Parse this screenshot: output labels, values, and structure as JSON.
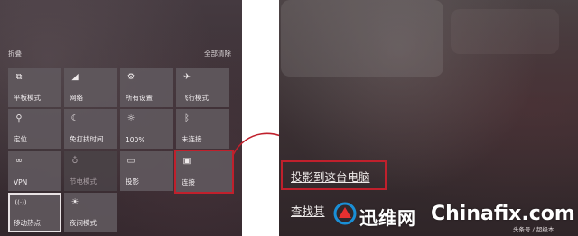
{
  "action_center": {
    "collapse_label": "折叠",
    "clear_all_label": "全部清除",
    "tiles": [
      {
        "label": "平板模式",
        "icon": "tablet-mode-icon",
        "glyph": "⧉",
        "state": "on"
      },
      {
        "label": "网络",
        "icon": "network-icon",
        "glyph": "◢",
        "state": "on"
      },
      {
        "label": "所有设置",
        "icon": "gear-icon",
        "glyph": "⚙",
        "state": "on"
      },
      {
        "label": "飞行模式",
        "icon": "airplane-icon",
        "glyph": "✈",
        "state": "on"
      },
      {
        "label": "定位",
        "icon": "location-icon",
        "glyph": "⚲",
        "state": "on"
      },
      {
        "label": "免打扰时间",
        "icon": "moon-icon",
        "glyph": "☾",
        "state": "on"
      },
      {
        "label": "100%",
        "icon": "brightness-icon",
        "glyph": "☼",
        "state": "on"
      },
      {
        "label": "未连接",
        "icon": "bluetooth-icon",
        "glyph": "ᛒ",
        "state": "on"
      },
      {
        "label": "VPN",
        "icon": "vpn-icon",
        "glyph": "∞",
        "state": "on"
      },
      {
        "label": "节电模式",
        "icon": "battery-saver-icon",
        "glyph": "♁",
        "state": "off"
      },
      {
        "label": "投影",
        "icon": "project-icon",
        "glyph": "▭",
        "state": "on"
      },
      {
        "label": "连接",
        "icon": "connect-icon",
        "glyph": "▣",
        "state": "on"
      },
      {
        "label": "移动热点",
        "icon": "hotspot-icon",
        "glyph": "((·))",
        "state": "on"
      },
      {
        "label": "夜间模式",
        "icon": "night-light-icon",
        "glyph": "☀",
        "state": "on"
      }
    ]
  },
  "connect_panel": {
    "project_link": "投影到这台电脑",
    "find_link": "查找其"
  },
  "watermark": {
    "cn": "迅维网",
    "en": "Chinafix.com",
    "small": "头条号 / 超级本"
  },
  "colors": {
    "highlight_red": "#c0202c",
    "tile_bg": "#605a5d"
  }
}
